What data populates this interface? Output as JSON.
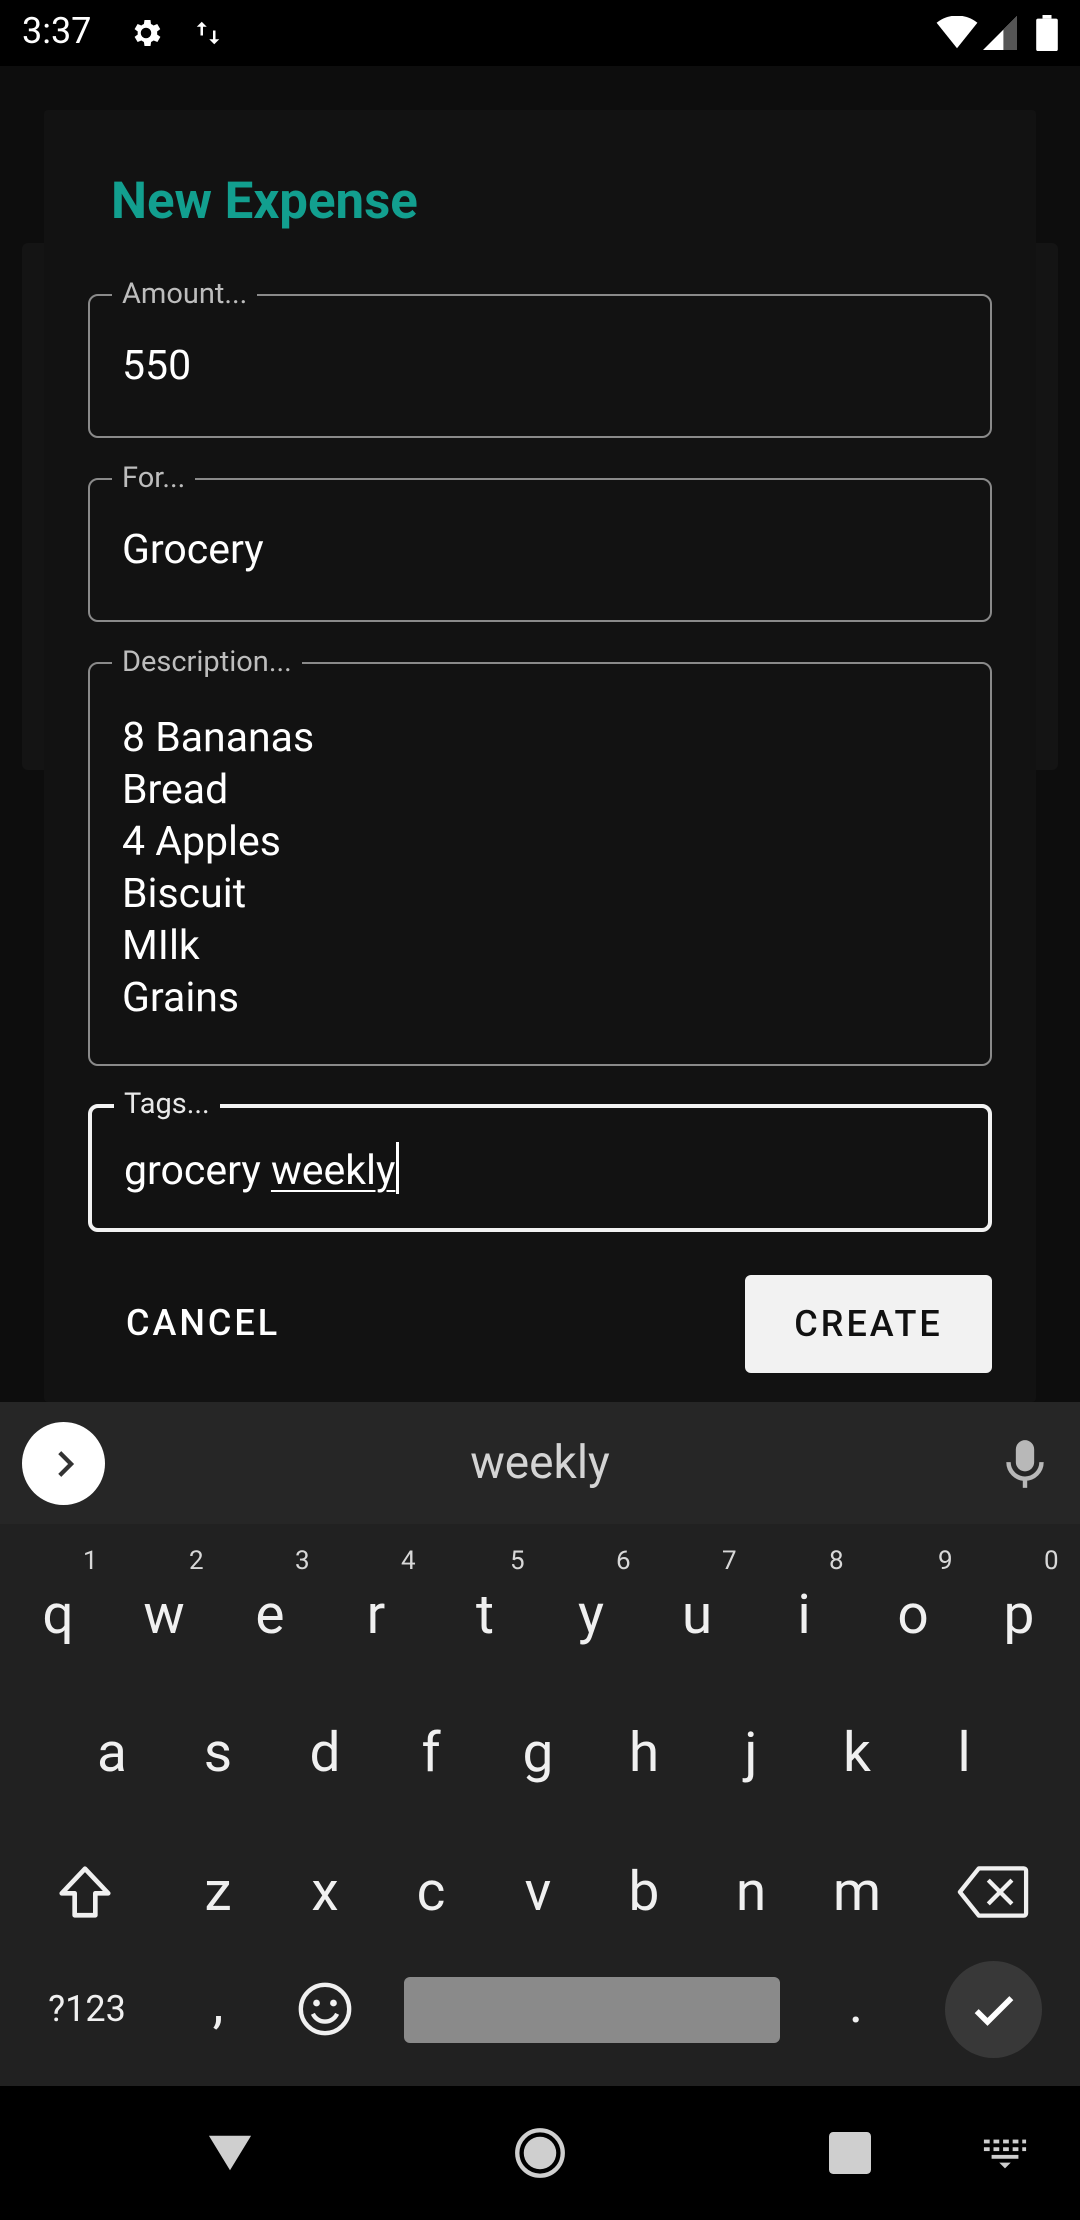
{
  "status_bar": {
    "time": "3:37"
  },
  "dialog": {
    "title": "New Expense",
    "fields": {
      "amount": {
        "label": "Amount...",
        "value": "550"
      },
      "for": {
        "label": "For...",
        "value": "Grocery"
      },
      "description": {
        "label": "Description...",
        "lines": [
          "8 Bananas",
          "Bread",
          "4 Apples",
          "Biscuit",
          "MIlk",
          "Grains"
        ]
      },
      "tags": {
        "label": "Tags...",
        "value_prefix": "grocery ",
        "value_current_word": "weekly"
      }
    },
    "cancel_label": "CANCEL",
    "create_label": "CREATE"
  },
  "keyboard": {
    "suggestion": "weekly",
    "row1": [
      {
        "key": "q",
        "hint": "1"
      },
      {
        "key": "w",
        "hint": "2"
      },
      {
        "key": "e",
        "hint": "3"
      },
      {
        "key": "r",
        "hint": "4"
      },
      {
        "key": "t",
        "hint": "5"
      },
      {
        "key": "y",
        "hint": "6"
      },
      {
        "key": "u",
        "hint": "7"
      },
      {
        "key": "i",
        "hint": "8"
      },
      {
        "key": "o",
        "hint": "9"
      },
      {
        "key": "p",
        "hint": "0"
      }
    ],
    "row2": [
      "a",
      "s",
      "d",
      "f",
      "g",
      "h",
      "j",
      "k",
      "l"
    ],
    "row3": [
      "z",
      "x",
      "c",
      "v",
      "b",
      "n",
      "m"
    ],
    "symbols_label": "?123",
    "comma": ",",
    "period": "."
  },
  "colors": {
    "accent": "#129f8f",
    "dialog_bg": "#121212",
    "keyboard_bg": "#212121"
  }
}
